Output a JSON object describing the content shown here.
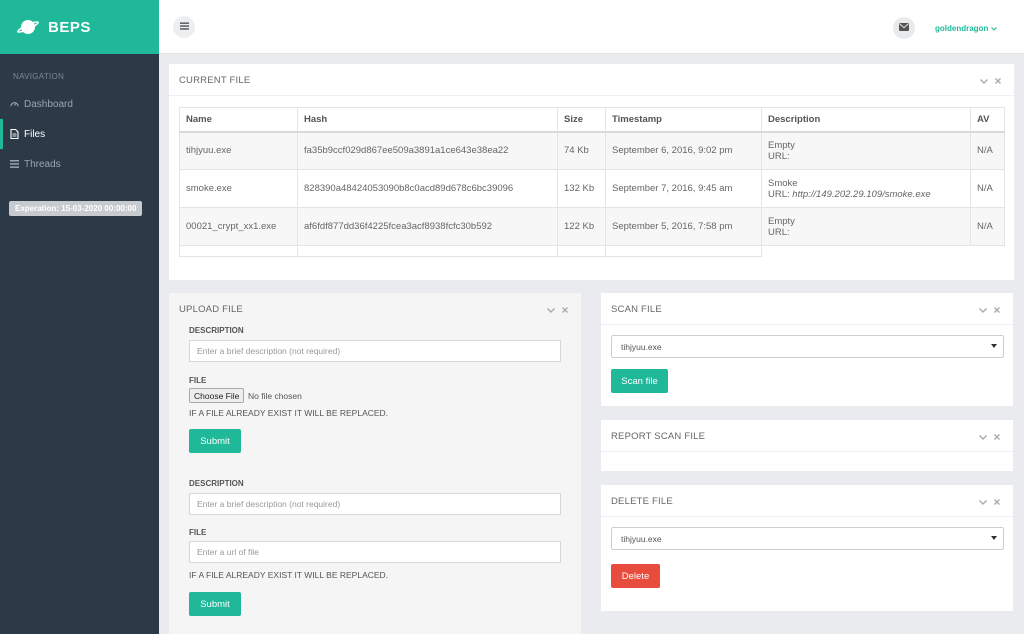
{
  "brand": {
    "title": "BEPS",
    "icon": "planet-icon"
  },
  "sidebar": {
    "heading": "NAVIGATION",
    "items": [
      {
        "label": "Dashboard",
        "icon": "dashboard-icon",
        "active": false
      },
      {
        "label": "Files",
        "icon": "file-icon",
        "active": true
      },
      {
        "label": "Threads",
        "icon": "list-icon",
        "active": false
      }
    ],
    "expiration": "Experation: 15-03-2020 00:00:00"
  },
  "topbar": {
    "menu_icon": "hamburger-icon",
    "mail_icon": "envelope-icon",
    "user": "goldendragon",
    "user_caret": "chevron-down-icon"
  },
  "current_file": {
    "title": "CURRENT FILE",
    "columns": [
      "Name",
      "Hash",
      "Size",
      "Timestamp",
      "Description",
      "AV"
    ],
    "rows": [
      {
        "name": "tihjyuu.exe",
        "hash": "fa35b9ccf029d867ee509a3891a1ce643e38ea22",
        "size": "74 Kb",
        "timestamp": "September 6, 2016, 9:02 pm",
        "desc": "Empty",
        "url_label": "URL:",
        "url": "",
        "av": "N/A"
      },
      {
        "name": "smoke.exe",
        "hash": "828390a48424053090b8c0acd89d678c6bc39096",
        "size": "132 Kb",
        "timestamp": "September 7, 2016, 9:45 am",
        "desc": "Smoke",
        "url_label": "URL:",
        "url": "http://149.202.29.109/smoke.exe",
        "av": "N/A"
      },
      {
        "name": "00021_crypt_xx1.exe",
        "hash": "af6fdf877dd36f4225fcea3acf8938fcfc30b592",
        "size": "122 Kb",
        "timestamp": "September 5, 2016, 7:58 pm",
        "desc": "Empty",
        "url_label": "URL:",
        "url": "",
        "av": "N/A"
      }
    ]
  },
  "upload_file": {
    "title": "UPLOAD FILE",
    "form1": {
      "desc_label": "DESCRIPTION",
      "desc_placeholder": "Enter a brief description (not required)",
      "file_label": "FILE",
      "choose_label": "Choose File",
      "file_status": "No file chosen",
      "note": "IF A FILE ALREADY EXIST IT WILL BE REPLACED.",
      "submit": "Submit"
    },
    "form2": {
      "desc_label": "DESCRIPTION",
      "desc_placeholder": "Enter a brief description (not required)",
      "file_label": "FILE",
      "url_placeholder": "Enter a url of file",
      "note": "IF A FILE ALREADY EXIST IT WILL BE REPLACED.",
      "submit": "Submit"
    }
  },
  "scan_file": {
    "title": "SCAN FILE",
    "selected": "tihjyuu.exe",
    "button": "Scan file"
  },
  "report_scan_file": {
    "title": "REPORT SCAN FILE"
  },
  "delete_file": {
    "title": "DELETE FILE",
    "selected": "tihjyuu.exe",
    "button": "Delete"
  },
  "panel_tools": {
    "collapse_icon": "chevron-down-icon",
    "close_icon": "close-icon"
  },
  "colors": {
    "accent": "#1fb99a",
    "sidebar": "#2c3a47",
    "danger": "#e74c3c"
  }
}
